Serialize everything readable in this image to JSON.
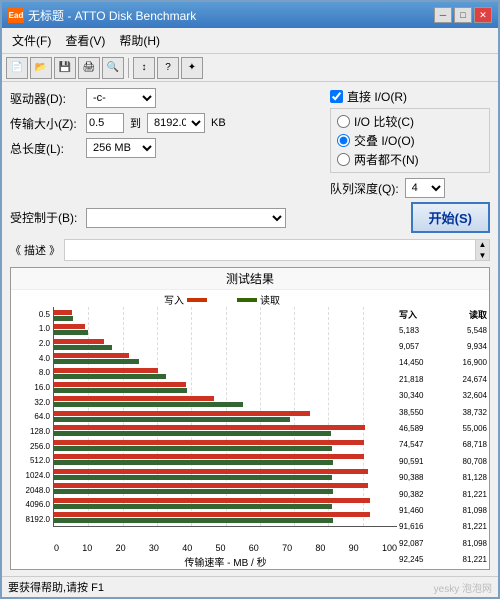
{
  "window": {
    "title": "无标题 - ATTO Disk Benchmark",
    "icon": "Ead"
  },
  "menu": {
    "items": [
      "文件(F)",
      "查看(V)",
      "帮助(H)"
    ]
  },
  "toolbar": {
    "buttons": [
      "new",
      "open",
      "save",
      "print",
      "preview",
      "separator",
      "help",
      "about"
    ]
  },
  "controls": {
    "drive_label": "驱动器(D):",
    "drive_value": "-c-",
    "transfer_label": "传输大小(Z):",
    "transfer_from": "0.5",
    "transfer_to": "8192.0",
    "transfer_unit": "KB",
    "total_label": "总长度(L):",
    "total_value": "256 MB",
    "controlled_label": "受控制于(B):",
    "desc_label": "《 描述 》",
    "direct_io_label": "直接 I/O(R)",
    "io_compare_label": "I/O 比较(C)",
    "overlapped_io_label": "交叠 I/O(O)",
    "neither_label": "两者都不(N)",
    "queue_label": "队列深度(Q):",
    "queue_value": "4",
    "start_label": "开始(S)"
  },
  "chart": {
    "title": "测试结果",
    "write_label": "写入",
    "read_label": "读取",
    "x_axis_labels": [
      "0",
      "10",
      "20",
      "30",
      "40",
      "50",
      "60",
      "70",
      "80",
      "90",
      "100"
    ],
    "x_axis_unit": "传输速率 - MB / 秒",
    "y_labels": [
      "0.5",
      "1.0",
      "2.0",
      "4.0",
      "8.0",
      "16.0",
      "32.0",
      "64.0",
      "128.0",
      "256.0",
      "512.0",
      "1024.0",
      "2048.0",
      "4096.0",
      "8192.0"
    ],
    "values_header": [
      "写入",
      "读取"
    ],
    "rows": [
      {
        "label": "0.5",
        "write": 5183,
        "read": 5548,
        "write_pct": 5.2,
        "read_pct": 5.5
      },
      {
        "label": "1.0",
        "write": 9057,
        "read": 9934,
        "write_pct": 9.1,
        "read_pct": 9.9
      },
      {
        "label": "2.0",
        "write": 14450,
        "read": 16900,
        "write_pct": 14.5,
        "read_pct": 16.9
      },
      {
        "label": "4.0",
        "write": 21818,
        "read": 24674,
        "write_pct": 21.8,
        "read_pct": 24.7
      },
      {
        "label": "8.0",
        "write": 30340,
        "read": 32604,
        "write_pct": 30.3,
        "read_pct": 32.6
      },
      {
        "label": "16.0",
        "write": 38550,
        "read": 38732,
        "write_pct": 38.6,
        "read_pct": 38.7
      },
      {
        "label": "32.0",
        "write": 46589,
        "read": 55006,
        "write_pct": 46.6,
        "read_pct": 55.0
      },
      {
        "label": "64.0",
        "write": 74547,
        "read": 68718,
        "write_pct": 74.5,
        "read_pct": 68.7
      },
      {
        "label": "128.0",
        "write": 90591,
        "read": 80708,
        "write_pct": 90.6,
        "read_pct": 80.7
      },
      {
        "label": "256.0",
        "write": 90388,
        "read": 81128,
        "write_pct": 90.4,
        "read_pct": 81.1
      },
      {
        "label": "512.0",
        "write": 90382,
        "read": 81221,
        "write_pct": 90.4,
        "read_pct": 81.2
      },
      {
        "label": "1024.0",
        "write": 91460,
        "read": 81098,
        "write_pct": 91.5,
        "read_pct": 81.1
      },
      {
        "label": "2048.0",
        "write": 91616,
        "read": 81221,
        "write_pct": 91.6,
        "read_pct": 81.2
      },
      {
        "label": "4096.0",
        "write": 92087,
        "read": 81098,
        "write_pct": 92.1,
        "read_pct": 81.1
      },
      {
        "label": "8192.0",
        "write": 92245,
        "read": 81221,
        "write_pct": 92.2,
        "read_pct": 81.2
      }
    ]
  },
  "status_bar": {
    "text": "要获得帮助,请按 F1"
  },
  "watermark": {
    "site": "yesky",
    "domain": "泡泡网"
  }
}
